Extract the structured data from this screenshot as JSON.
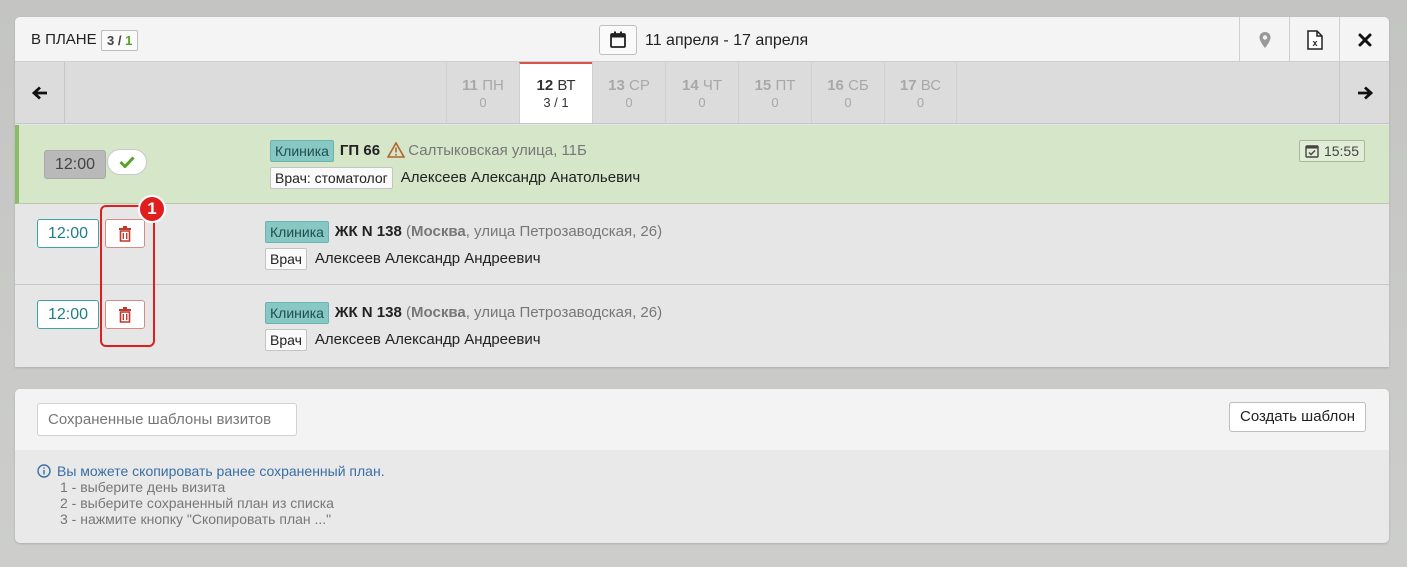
{
  "header": {
    "plan_label": "В ПЛАНЕ",
    "plan_count_total": "3",
    "plan_count_sep": "/",
    "plan_count_done": "1",
    "date_range": "11 апреля - 17 апреля",
    "icons": [
      "calendar-icon",
      "map-marker-icon",
      "excel-icon",
      "close-icon"
    ]
  },
  "days": [
    {
      "num": "11",
      "dow": "ПН",
      "count": "0",
      "active": false
    },
    {
      "num": "12",
      "dow": "ВТ",
      "count": "3 / 1",
      "active": true
    },
    {
      "num": "13",
      "dow": "СР",
      "count": "0",
      "active": false
    },
    {
      "num": "14",
      "dow": "ЧТ",
      "count": "0",
      "active": false
    },
    {
      "num": "15",
      "dow": "ПТ",
      "count": "0",
      "active": false
    },
    {
      "num": "16",
      "dow": "СБ",
      "count": "0",
      "active": false
    },
    {
      "num": "17",
      "dow": "ВС",
      "count": "0",
      "active": false
    }
  ],
  "visits": [
    {
      "time": "12:00",
      "status": "done",
      "tag": "Клиника",
      "name": "ГП 66",
      "address": "Салтыковская улица, 11Б",
      "doctor_tag": "Врач: стоматолог",
      "doctor": "Алексеев Александр Анатольевич",
      "fact_time": "15:55"
    },
    {
      "time": "12:00",
      "status": "planned",
      "tag": "Клиника",
      "name": "ЖК N 138",
      "city": "Москва",
      "address": ", улица Петрозаводская, 26)",
      "doctor_tag": "Врач",
      "doctor": "Алексеев Александр Андреевич"
    },
    {
      "time": "12:00",
      "status": "planned",
      "tag": "Клиника",
      "name": "ЖК N 138",
      "city": "Москва",
      "address": ", улица Петрозаводская, 26)",
      "doctor_tag": "Врач",
      "doctor": "Алексеев Александр Андреевич"
    }
  ],
  "annotation": {
    "marker": "1",
    "color": "#e01e1e"
  },
  "templates": {
    "saved_placeholder": "Сохраненные шаблоны визитов",
    "create_label": "Создать шаблон",
    "info_lead": "Вы можете скопировать ранее сохраненный план.",
    "steps": [
      "1 - выберите день визита",
      "2 - выберите сохраненный план из списка",
      "3 - нажмите кнопку \"Скопировать план ...\""
    ]
  },
  "colors": {
    "accent_teal": "#3ca3a9",
    "done_green": "#8cbb66",
    "danger": "#c0392b",
    "active_day": "#d9534f"
  }
}
